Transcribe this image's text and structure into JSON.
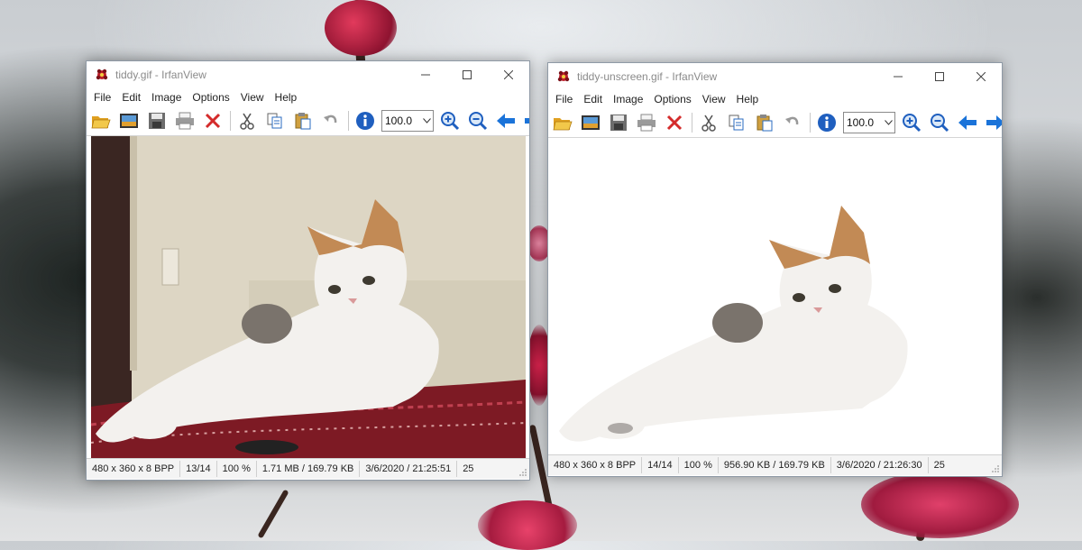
{
  "windows": [
    {
      "title": "tiddy.gif - IrfanView",
      "menu": [
        "File",
        "Edit",
        "Image",
        "Options",
        "View",
        "Help"
      ],
      "zoom_value": "100.0",
      "image": "cat photo with wall background",
      "status": [
        "480 x 360 x 8 BPP",
        "13/14",
        "100 %",
        "1.71 MB / 169.79 KB",
        "3/6/2020 / 21:25:51",
        "25"
      ]
    },
    {
      "title": "tiddy-unscreen.gif - IrfanView",
      "menu": [
        "File",
        "Edit",
        "Image",
        "Options",
        "View",
        "Help"
      ],
      "zoom_value": "100.0",
      "image": "cat cut-out on white background",
      "status": [
        "480 x 360 x 8 BPP",
        "14/14",
        "100 %",
        "956.90 KB / 169.79 KB",
        "3/6/2020 / 21:26:30",
        "25"
      ]
    }
  ],
  "toolbar_icons": [
    "open-folder-icon",
    "slideshow-icon",
    "save-icon",
    "print-icon",
    "delete-icon",
    "cut-icon",
    "copy-icon",
    "paste-icon",
    "undo-icon",
    "info-icon",
    "zoom-in-icon",
    "zoom-out-icon",
    "previous-icon",
    "next-icon"
  ],
  "colors": {
    "delete_red": "#d42b2b",
    "info_blue": "#1f5fbf",
    "arrow_blue": "#1a73d9",
    "folder_yellow": "#f2b82a",
    "cat_orange": "#c28a55",
    "cat_white": "#f3f1ee",
    "rug_red": "#7d1a24",
    "wall_beige": "#ddd6c4"
  }
}
